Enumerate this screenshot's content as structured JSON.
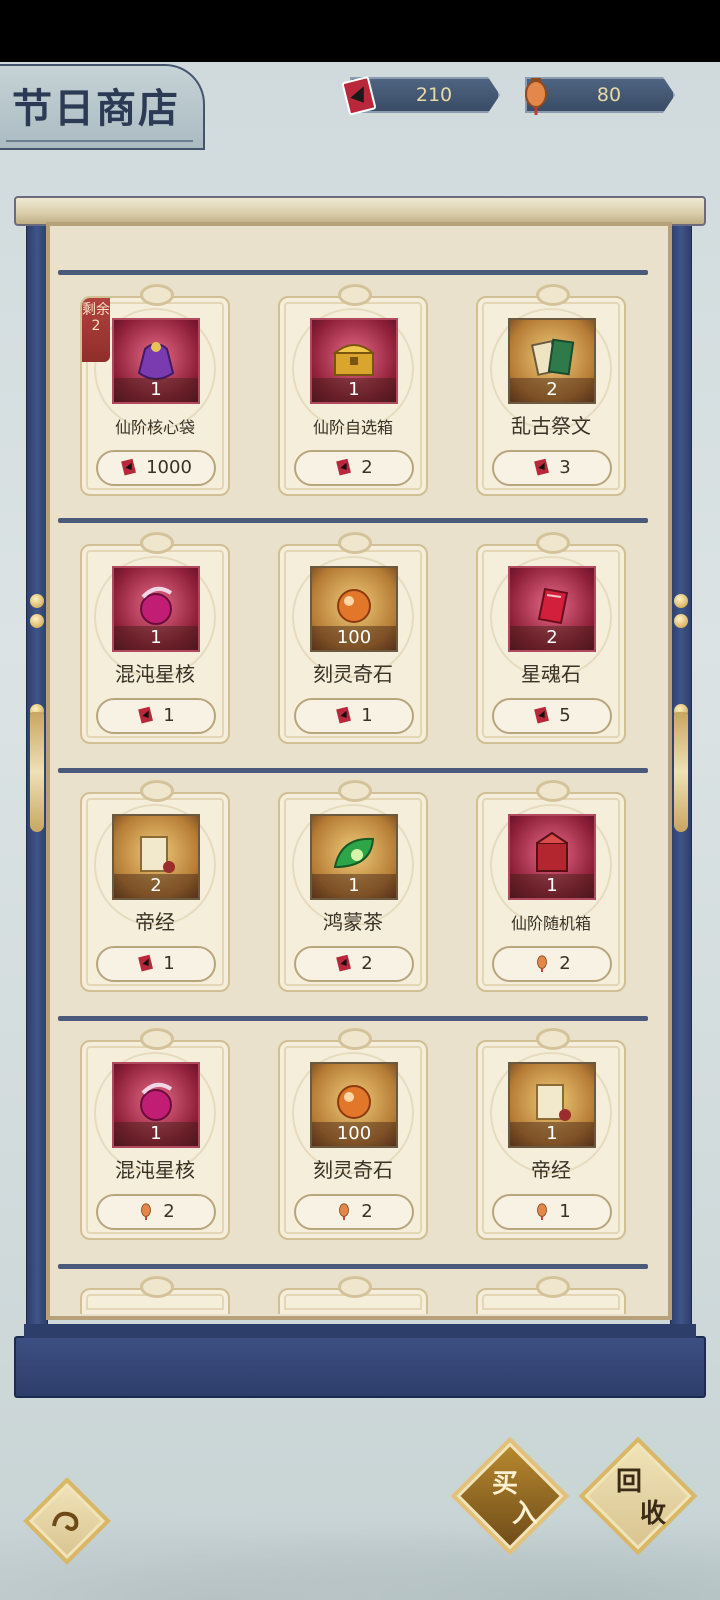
{
  "header": {
    "title": "节日商店",
    "currency_ticket": "210",
    "currency_lantern": "80"
  },
  "colors": {
    "frame_blue": "#3b4f82",
    "parchment": "#e9e1cb",
    "card_bg": "#f4eedb",
    "gold": "#d9b765",
    "remain_red": "#a63a37"
  },
  "items": [
    {
      "name": "仙阶核心袋",
      "qty": "1",
      "price": "1000",
      "currency": "ticket-icon",
      "remain": "剩余2",
      "art": "purple-pouch-icon",
      "bg": "red"
    },
    {
      "name": "仙阶自选箱",
      "qty": "1",
      "price": "2",
      "currency": "ticket-icon",
      "art": "gold-chest-icon",
      "bg": "red"
    },
    {
      "name": "乱古祭文",
      "qty": "2",
      "price": "3",
      "currency": "ticket-icon",
      "art": "book-icon",
      "bg": "gold"
    },
    {
      "name": "混沌星核",
      "qty": "1",
      "price": "1",
      "currency": "ticket-icon",
      "art": "orb-icon",
      "bg": "red"
    },
    {
      "name": "刻灵奇石",
      "qty": "100",
      "price": "1",
      "currency": "ticket-icon",
      "art": "stone-icon",
      "bg": "gold"
    },
    {
      "name": "星魂石",
      "qty": "2",
      "price": "5",
      "currency": "ticket-icon",
      "art": "crystal-icon",
      "bg": "red"
    },
    {
      "name": "帝经",
      "qty": "2",
      "price": "1",
      "currency": "ticket-icon",
      "art": "scroll-icon",
      "bg": "gold"
    },
    {
      "name": "鸿蒙茶",
      "qty": "1",
      "price": "2",
      "currency": "ticket-icon",
      "art": "tea-leaf-icon",
      "bg": "gold"
    },
    {
      "name": "仙阶随机箱",
      "qty": "1",
      "price": "2",
      "currency": "lantern-icon",
      "art": "red-box-icon",
      "bg": "red"
    },
    {
      "name": "混沌星核",
      "qty": "1",
      "price": "2",
      "currency": "lantern-icon",
      "art": "orb-icon",
      "bg": "red"
    },
    {
      "name": "刻灵奇石",
      "qty": "100",
      "price": "2",
      "currency": "lantern-icon",
      "art": "stone-icon",
      "bg": "gold"
    },
    {
      "name": "帝经",
      "qty": "1",
      "price": "1",
      "currency": "lantern-icon",
      "art": "scroll-icon",
      "bg": "gold"
    }
  ],
  "buttons": {
    "buy_top": "买",
    "buy_bottom": "入",
    "recycle_top": "回",
    "recycle_bottom": "收"
  }
}
